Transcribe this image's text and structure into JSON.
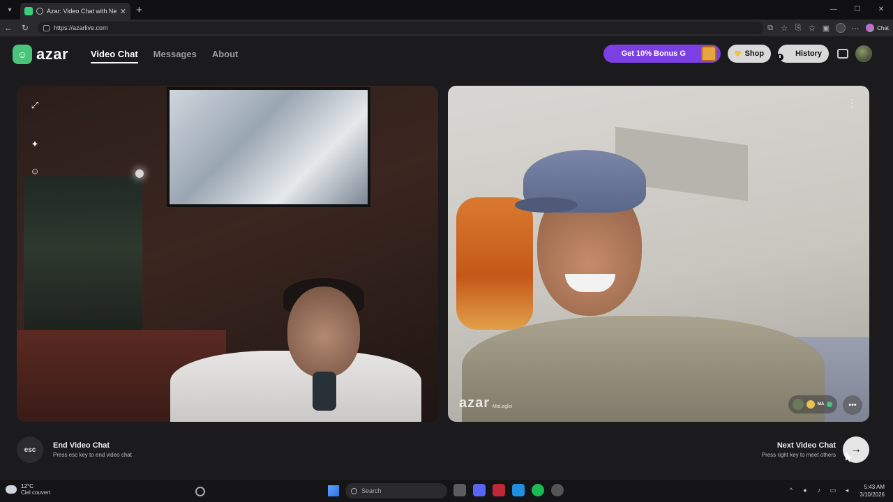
{
  "browser": {
    "tab_title": "Azar: Video Chat with New Pe",
    "tab_close": "✕",
    "new_tab": "+",
    "url": "https://azarlive.com",
    "copilot_label": "Chat",
    "window_controls": [
      "—",
      "☐",
      "✕"
    ]
  },
  "header": {
    "brand": "azar",
    "nav": [
      {
        "label": "Video Chat",
        "active": true
      },
      {
        "label": "Messages",
        "active": false
      },
      {
        "label": "About",
        "active": false
      }
    ],
    "promo_label": "Get 10% Bonus G",
    "shop_label": "Shop",
    "history_label": "History"
  },
  "left_pane": {
    "tools": [
      "expand-icon",
      "magic-wand-icon",
      "sticker-face-icon"
    ]
  },
  "right_pane": {
    "watermark": "azar",
    "watermark_handle": "Mid.egliri",
    "badge_label": "MA",
    "more_icon": "⋮",
    "chat_icon": "•••"
  },
  "footer": {
    "esc_key": "esc",
    "end_title": "End Video Chat",
    "end_hint": "Press esc key to end video chat",
    "next_title": "Next Video Chat",
    "next_hint": "Press right key to meet others",
    "next_arrow": "→"
  },
  "taskbar": {
    "temperature": "12°C",
    "weather": "Ciel couvert",
    "search_placeholder": "Search",
    "time": "5:43 AM",
    "date": "3/10/2026"
  },
  "colors": {
    "brand_green": "#48c47b",
    "promo_purple": "#7b3fe4",
    "background": "#1b1b1d"
  }
}
